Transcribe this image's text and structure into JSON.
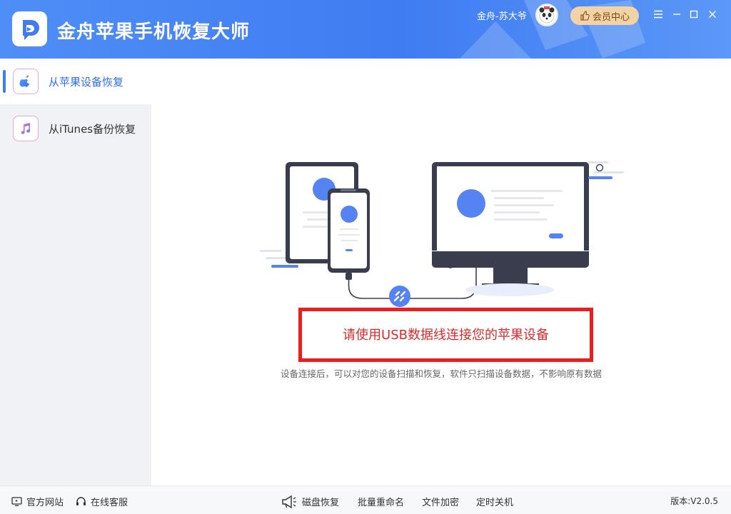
{
  "app": {
    "title": "金舟苹果手机恢复大师",
    "user_name": "金舟-苏大爷",
    "vip_label": "会员中心"
  },
  "sidebar": {
    "items": [
      {
        "label": "从苹果设备恢复",
        "icon": "apple-icon",
        "active": true
      },
      {
        "label": "从iTunes备份恢复",
        "icon": "music-note-icon",
        "active": false
      }
    ]
  },
  "main": {
    "prompt": "请使用USB数据线连接您的苹果设备",
    "subtext": "设备连接后，可以对您的设备扫描和恢复，软件只扫描设备数据，不影响原有数据"
  },
  "footer": {
    "official_site": "官方网站",
    "online_service": "在线客服",
    "disk_recovery": "磁盘恢复",
    "batch_rename": "批量重命名",
    "file_encrypt": "文件加密",
    "timed_shutdown": "定时关机",
    "version": "版本:V2.0.5"
  },
  "colors": {
    "header": "#3f7cf2",
    "accent": "#5583f3",
    "highlight_box": "#ee1c1c",
    "prompt_text": "#d92b2b",
    "vip_bg": "#f3d3a6"
  }
}
